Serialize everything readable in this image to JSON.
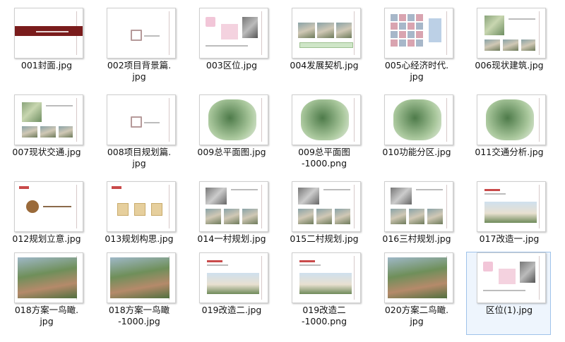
{
  "files": [
    {
      "name": "001封面.jpg",
      "kind": "cover"
    },
    {
      "name": "002项目背景篇.\njpg",
      "kind": "section"
    },
    {
      "name": "003区位.jpg",
      "kind": "location"
    },
    {
      "name": "004发展契机.jpg",
      "kind": "photos-row"
    },
    {
      "name": "005心经济时代.\njpg",
      "kind": "collage"
    },
    {
      "name": "006现状建筑.jpg",
      "kind": "map-photos"
    },
    {
      "name": "007现状交通.jpg",
      "kind": "map-photos"
    },
    {
      "name": "008项目规划篇.\njpg",
      "kind": "section"
    },
    {
      "name": "009总平面图.jpg",
      "kind": "masterplan"
    },
    {
      "name": "009总平面图\n-1000.png",
      "kind": "masterplan"
    },
    {
      "name": "010功能分区.jpg",
      "kind": "masterplan"
    },
    {
      "name": "011交通分析.jpg",
      "kind": "masterplan"
    },
    {
      "name": "012规划立意.jpg",
      "kind": "concept"
    },
    {
      "name": "013规划构思.jpg",
      "kind": "boxes"
    },
    {
      "name": "014一村规划.jpg",
      "kind": "village"
    },
    {
      "name": "015二村规划.jpg",
      "kind": "village"
    },
    {
      "name": "016三村规划.jpg",
      "kind": "village"
    },
    {
      "name": "017改造一.jpg",
      "kind": "building"
    },
    {
      "name": "018方案一鸟瞰.\njpg",
      "kind": "aerial"
    },
    {
      "name": "018方案一鸟瞰\n-1000.jpg",
      "kind": "aerial"
    },
    {
      "name": "019改造二.jpg",
      "kind": "building"
    },
    {
      "name": "019改造二\n-1000.png",
      "kind": "building"
    },
    {
      "name": "020方案二鸟瞰.\njpg",
      "kind": "aerial"
    },
    {
      "name": "区位(1).jpg",
      "kind": "location",
      "selected": true
    }
  ]
}
